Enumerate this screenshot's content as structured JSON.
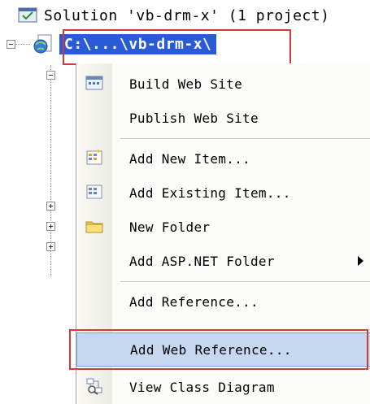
{
  "solution": {
    "label": "Solution 'vb-drm-x' (1 project)",
    "icon": "solution-icon"
  },
  "project": {
    "label": "C:\\...\\vb-drm-x\\",
    "icon": "web-project-icon"
  },
  "context_menu": {
    "items": [
      {
        "label": "Build Web Site",
        "icon": "build-icon"
      },
      {
        "label": "Publish Web Site",
        "icon": ""
      },
      {
        "label": "Add New Item...",
        "icon": "new-item-icon"
      },
      {
        "label": "Add Existing Item...",
        "icon": "existing-item-icon"
      },
      {
        "label": "New Folder",
        "icon": "folder-icon"
      },
      {
        "label": "Add ASP.NET Folder",
        "icon": "",
        "submenu": true
      },
      {
        "label": "Add Reference...",
        "icon": ""
      },
      {
        "label": "Add Web Reference...",
        "icon": "",
        "selected": true
      },
      {
        "label": "View Class Diagram",
        "icon": "class-diagram-icon"
      }
    ]
  },
  "colors": {
    "selection_bg": "#2a5bd7",
    "menu_hover": "#c6d7f0",
    "callout": "#d23a3a"
  }
}
